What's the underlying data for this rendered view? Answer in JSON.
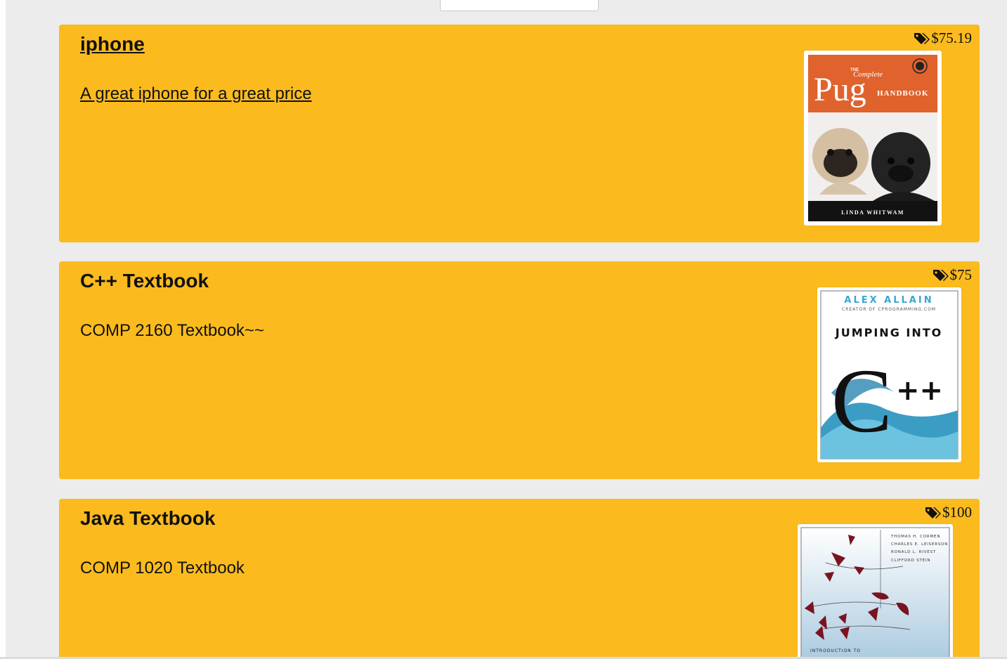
{
  "listings": [
    {
      "title": "iphone",
      "description": "A great iphone for a great price",
      "price": "$75.19",
      "icon": "price-tag-icon",
      "cover": {
        "small_text": "THE",
        "subtitle": "Complete",
        "title": "Pug",
        "title_suffix": "HANDBOOK",
        "author": "LINDA WHITWAM",
        "colors": {
          "top": "#e0622c",
          "bottom": "#121212"
        }
      }
    },
    {
      "title": "C++ Textbook",
      "description": "COMP 2160 Textbook~~",
      "price": "$75",
      "icon": "price-tag-icon",
      "cover": {
        "author": "ALEX ALLAIN",
        "author_note": "CREATOR OF CPROGRAMMING.COM",
        "title": "JUMPING INTO",
        "title_big": "C",
        "title_plus": "++",
        "colors": {
          "accent": "#3aa6d0"
        }
      }
    },
    {
      "title": "Java Textbook",
      "description": "COMP 1020 Textbook",
      "price": "$100",
      "icon": "price-tag-icon",
      "cover": {
        "authors": [
          "THOMAS H. CORMEN",
          "CHARLES E. LEISERSON",
          "RONALD L. RIVEST",
          "CLIFFORD STEIN"
        ],
        "title_start": "INTRODUCTION TO",
        "colors": {
          "accent": "#7a1320"
        }
      }
    }
  ]
}
